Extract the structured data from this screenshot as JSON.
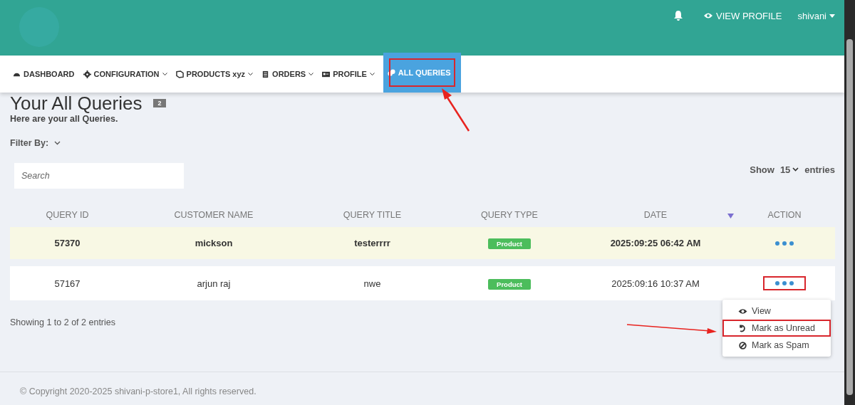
{
  "header": {
    "user_links": [
      {
        "kind": "profile",
        "label": "VIEW PROFILE"
      },
      {
        "kind": "user",
        "label": "shivani"
      }
    ]
  },
  "nav": [
    {
      "kind": "dashboard",
      "label": "DASHBOARD",
      "dropdown": false,
      "selected": false,
      "highlighted": false
    },
    {
      "kind": "gear",
      "label": "CONFIGURATION",
      "dropdown": true,
      "selected": false,
      "highlighted": false
    },
    {
      "kind": "box",
      "label": "PRODUCTS xyz",
      "dropdown": true,
      "selected": false,
      "highlighted": false
    },
    {
      "kind": "list",
      "label": "ORDERS",
      "dropdown": true,
      "selected": false,
      "highlighted": false
    },
    {
      "kind": "card",
      "label": "PROFILE",
      "dropdown": true,
      "selected": false,
      "highlighted": false
    },
    {
      "kind": "chat",
      "label": "ALL QUERIES",
      "dropdown": false,
      "selected": true,
      "highlighted": true
    }
  ],
  "page": {
    "title": "Your All Queries",
    "count": "2",
    "subtitle": "Here are your all Queries.",
    "filter_label": "Filter By:"
  },
  "search": {
    "placeholder": "Search"
  },
  "length": {
    "before": "Show",
    "value": "15",
    "after": "entries"
  },
  "table": {
    "columns": [
      {
        "label": "QUERY ID",
        "sorted": false
      },
      {
        "label": "CUSTOMER NAME",
        "sorted": false
      },
      {
        "label": "QUERY TITLE",
        "sorted": false
      },
      {
        "label": "QUERY TYPE",
        "sorted": false
      },
      {
        "label": "DATE",
        "sorted": true
      },
      {
        "label": "ACTION",
        "sorted": false
      }
    ],
    "rows": [
      {
        "id": "57370",
        "customer": "mickson",
        "title": "testerrrr",
        "type": "Product",
        "date": "2025:09:25 06:42 AM",
        "unread": true,
        "highlighted": false
      },
      {
        "id": "57167",
        "customer": "arjun raj",
        "title": "nwe",
        "type": "Product",
        "date": "2025:09:16 10:37 AM",
        "unread": false,
        "highlighted": true
      }
    ]
  },
  "info": "Showing 1 to 2 of 2 entries",
  "menu": [
    {
      "kind": "eye",
      "label": "View",
      "highlighted": false
    },
    {
      "kind": "undo",
      "label": "Mark as Unread",
      "highlighted": true
    },
    {
      "kind": "ban",
      "label": "Mark as Spam",
      "highlighted": false
    }
  ],
  "footer": "© Copyright 2020-2025 shivani-p-store1, All rights reserved."
}
